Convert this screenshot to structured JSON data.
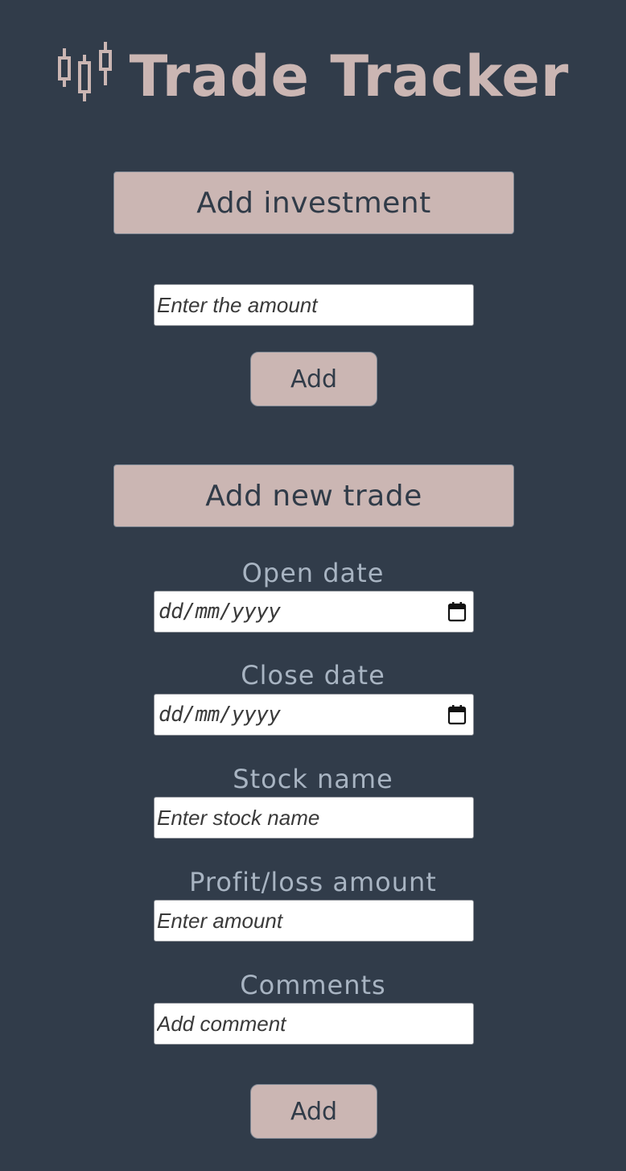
{
  "app": {
    "title": "Trade Tracker",
    "logo_icon": "candlestick-chart-icon"
  },
  "investment": {
    "section_label": "Add investment",
    "amount_placeholder": "Enter the amount",
    "add_label": "Add"
  },
  "trade": {
    "section_label": "Add new trade",
    "open_date_label": "Open date",
    "open_date_placeholder": "dd/mm/yyyy",
    "close_date_label": "Close date",
    "close_date_placeholder": "dd/mm/yyyy",
    "stock_name_label": "Stock name",
    "stock_name_placeholder": "Enter stock name",
    "profit_loss_label": "Profit/loss amount",
    "profit_loss_placeholder": "Enter amount",
    "comments_label": "Comments",
    "comments_placeholder": "Add comment",
    "add_label": "Add"
  },
  "colors": {
    "background": "#313c4a",
    "accent": "#cbb6b3",
    "label": "#a8b4c2",
    "button_text": "#303b48"
  }
}
